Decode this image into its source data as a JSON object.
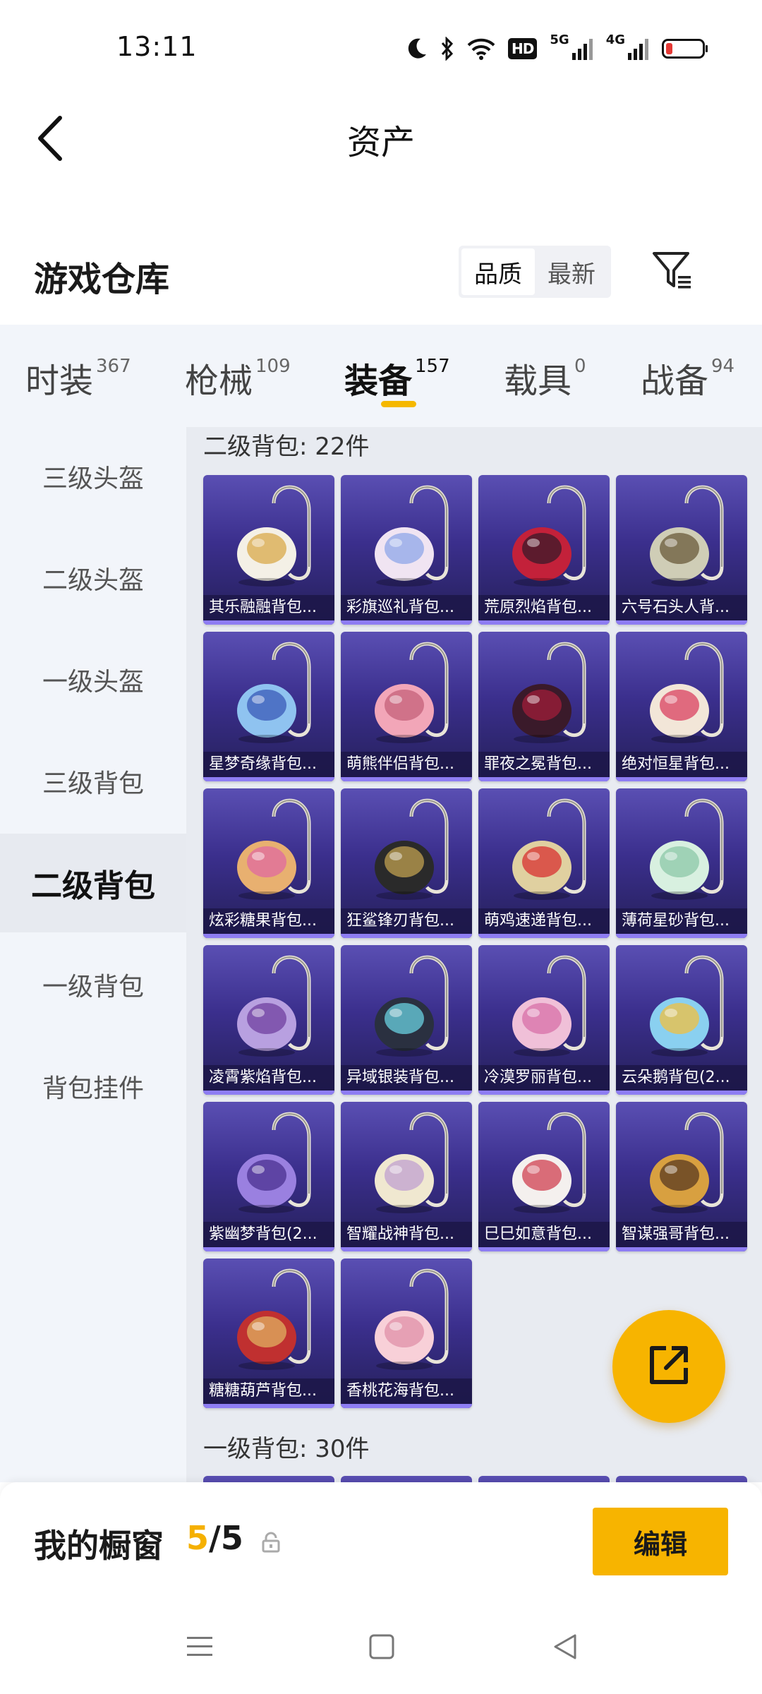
{
  "status_bar": {
    "time": "13:11",
    "hd_label": "HD",
    "network_1": "5G",
    "network_2": "4G"
  },
  "header": {
    "title": "资产"
  },
  "warehouse": {
    "title": "游戏仓库",
    "sort_options": [
      "品质",
      "最新"
    ],
    "sort_selected": "品质"
  },
  "tabs": [
    {
      "label": "时装",
      "count": "367"
    },
    {
      "label": "枪械",
      "count": "109"
    },
    {
      "label": "装备",
      "count": "157"
    },
    {
      "label": "载具",
      "count": "0"
    },
    {
      "label": "战备",
      "count": "94"
    }
  ],
  "active_tab": "装备",
  "sidebar": {
    "items": [
      "三级头盔",
      "二级头盔",
      "一级头盔",
      "三级背包",
      "二级背包",
      "一级背包",
      "背包挂件"
    ],
    "active": "二级背包"
  },
  "groups": [
    {
      "title": "二级背包: 22件",
      "items": [
        "其乐融融背包...",
        "彩旗巡礼背包...",
        "荒原烈焰背包...",
        "六号石头人背...",
        "星梦奇缘背包...",
        "萌熊伴侣背包...",
        "罪夜之冕背包...",
        "绝对恒星背包...",
        "炫彩糖果背包...",
        "狂鲨锋刃背包...",
        "萌鸡速递背包...",
        "薄荷星砂背包...",
        "凌霄紫焰背包...",
        "异域银装背包...",
        "冷漠罗丽背包...",
        "云朵鹅背包(2...",
        "紫幽梦背包(2...",
        "智耀战神背包...",
        "巳巳如意背包...",
        "智谋强哥背包...",
        "糖糖葫芦背包...",
        "香桃花海背包..."
      ]
    },
    {
      "title": "一级背包: 30件"
    }
  ],
  "showcase": {
    "title": "我的橱窗",
    "current": "5",
    "separator": "/",
    "total": "5",
    "edit_label": "编辑"
  },
  "colors": {
    "accent": "#f7b400",
    "card_top": "#5a4fb3",
    "card_bottom": "#241f58",
    "panel_bg": "#f2f5fa"
  },
  "icons": {
    "back": "chevron-left-icon",
    "filter": "filter-icon",
    "share": "share-external-icon",
    "lock": "lock-icon",
    "nav": [
      "menu-icon",
      "home-square-icon",
      "back-triangle-icon"
    ]
  }
}
